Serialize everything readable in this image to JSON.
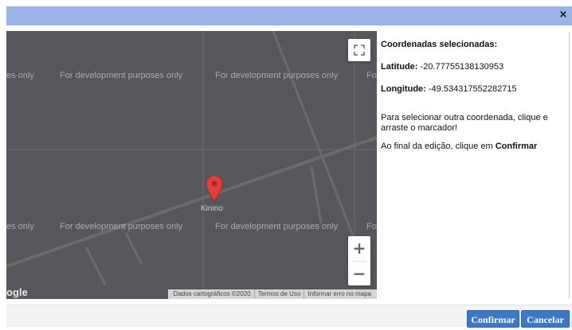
{
  "dialog": {
    "close_label": "×"
  },
  "map": {
    "watermark": "For development purposes only",
    "watermark_partial_left": "es only",
    "watermark_partial_right": "Fo",
    "marker_label": "Kinino",
    "google_logo": "ogle",
    "attribution": {
      "data": "Dados cartográficos ©2020",
      "terms": "Termos de Uso",
      "report": "Informar erro no mapa"
    },
    "zoom_in": "+",
    "zoom_out": "−",
    "colors": {
      "background": "#55575c",
      "road": "#6b6b68",
      "marker": "#e2413a"
    }
  },
  "info": {
    "title": "Coordenadas selecionadas:",
    "latitude_label": "Latitude:",
    "latitude_value": "-20.77755138130953",
    "longitude_label": "Longitude:",
    "longitude_value": "-49.534317552282715",
    "instruction": "Para selecionar outra coordenada, clique e arraste o marcador!",
    "final_prefix": "Ao final da edição, clique em",
    "final_action": "Confirmar"
  },
  "footer": {
    "confirm_label": "Confirmar",
    "cancel_label": "Cancelar",
    "colors": {
      "button": "#3c78c3"
    }
  }
}
